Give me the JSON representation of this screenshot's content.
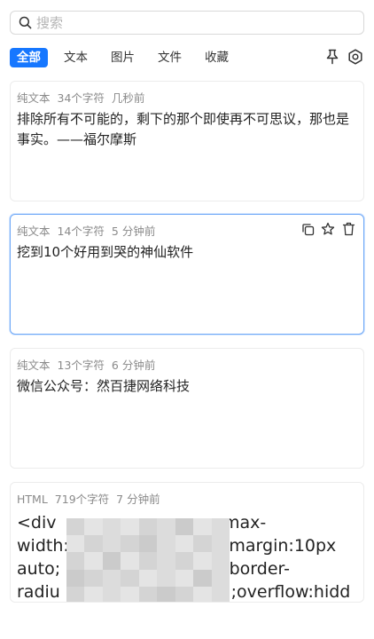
{
  "search": {
    "placeholder": "搜索",
    "value": ""
  },
  "tabs": [
    {
      "label": "全部",
      "active": true
    },
    {
      "label": "文本",
      "active": false
    },
    {
      "label": "图片",
      "active": false
    },
    {
      "label": "文件",
      "active": false
    },
    {
      "label": "收藏",
      "active": false
    }
  ],
  "toolbar_icons": [
    "pin-icon",
    "settings-icon"
  ],
  "card_action_icons": [
    "copy-icon",
    "star-icon",
    "delete-icon"
  ],
  "colors": {
    "accent": "#1677ff",
    "selected_border": "#6ea8f7"
  },
  "items": [
    {
      "type": "纯文本",
      "chars": "34个字符",
      "time": "几秒前",
      "content": "排除所有不可能的，剩下的那个即使再不可思议，那也是事实。——福尔摩斯",
      "selected": false
    },
    {
      "type": "纯文本",
      "chars": "14个字符",
      "time": "5 分钟前",
      "content": "挖到10个好用到哭的神仙软件",
      "selected": true
    },
    {
      "type": "纯文本",
      "chars": "13个字符",
      "time": "6 分钟前",
      "content": "微信公众号：然百捷网络科技",
      "selected": false
    },
    {
      "type": "HTML",
      "chars": "719个字符",
      "time": "7 分钟前",
      "lines": [
        "<div",
        "max-",
        "width:",
        ";margin:10px",
        "auto;",
        "';border-",
        "radiu",
        "a;overflow:hidden;"
      ],
      "selected": false
    }
  ]
}
